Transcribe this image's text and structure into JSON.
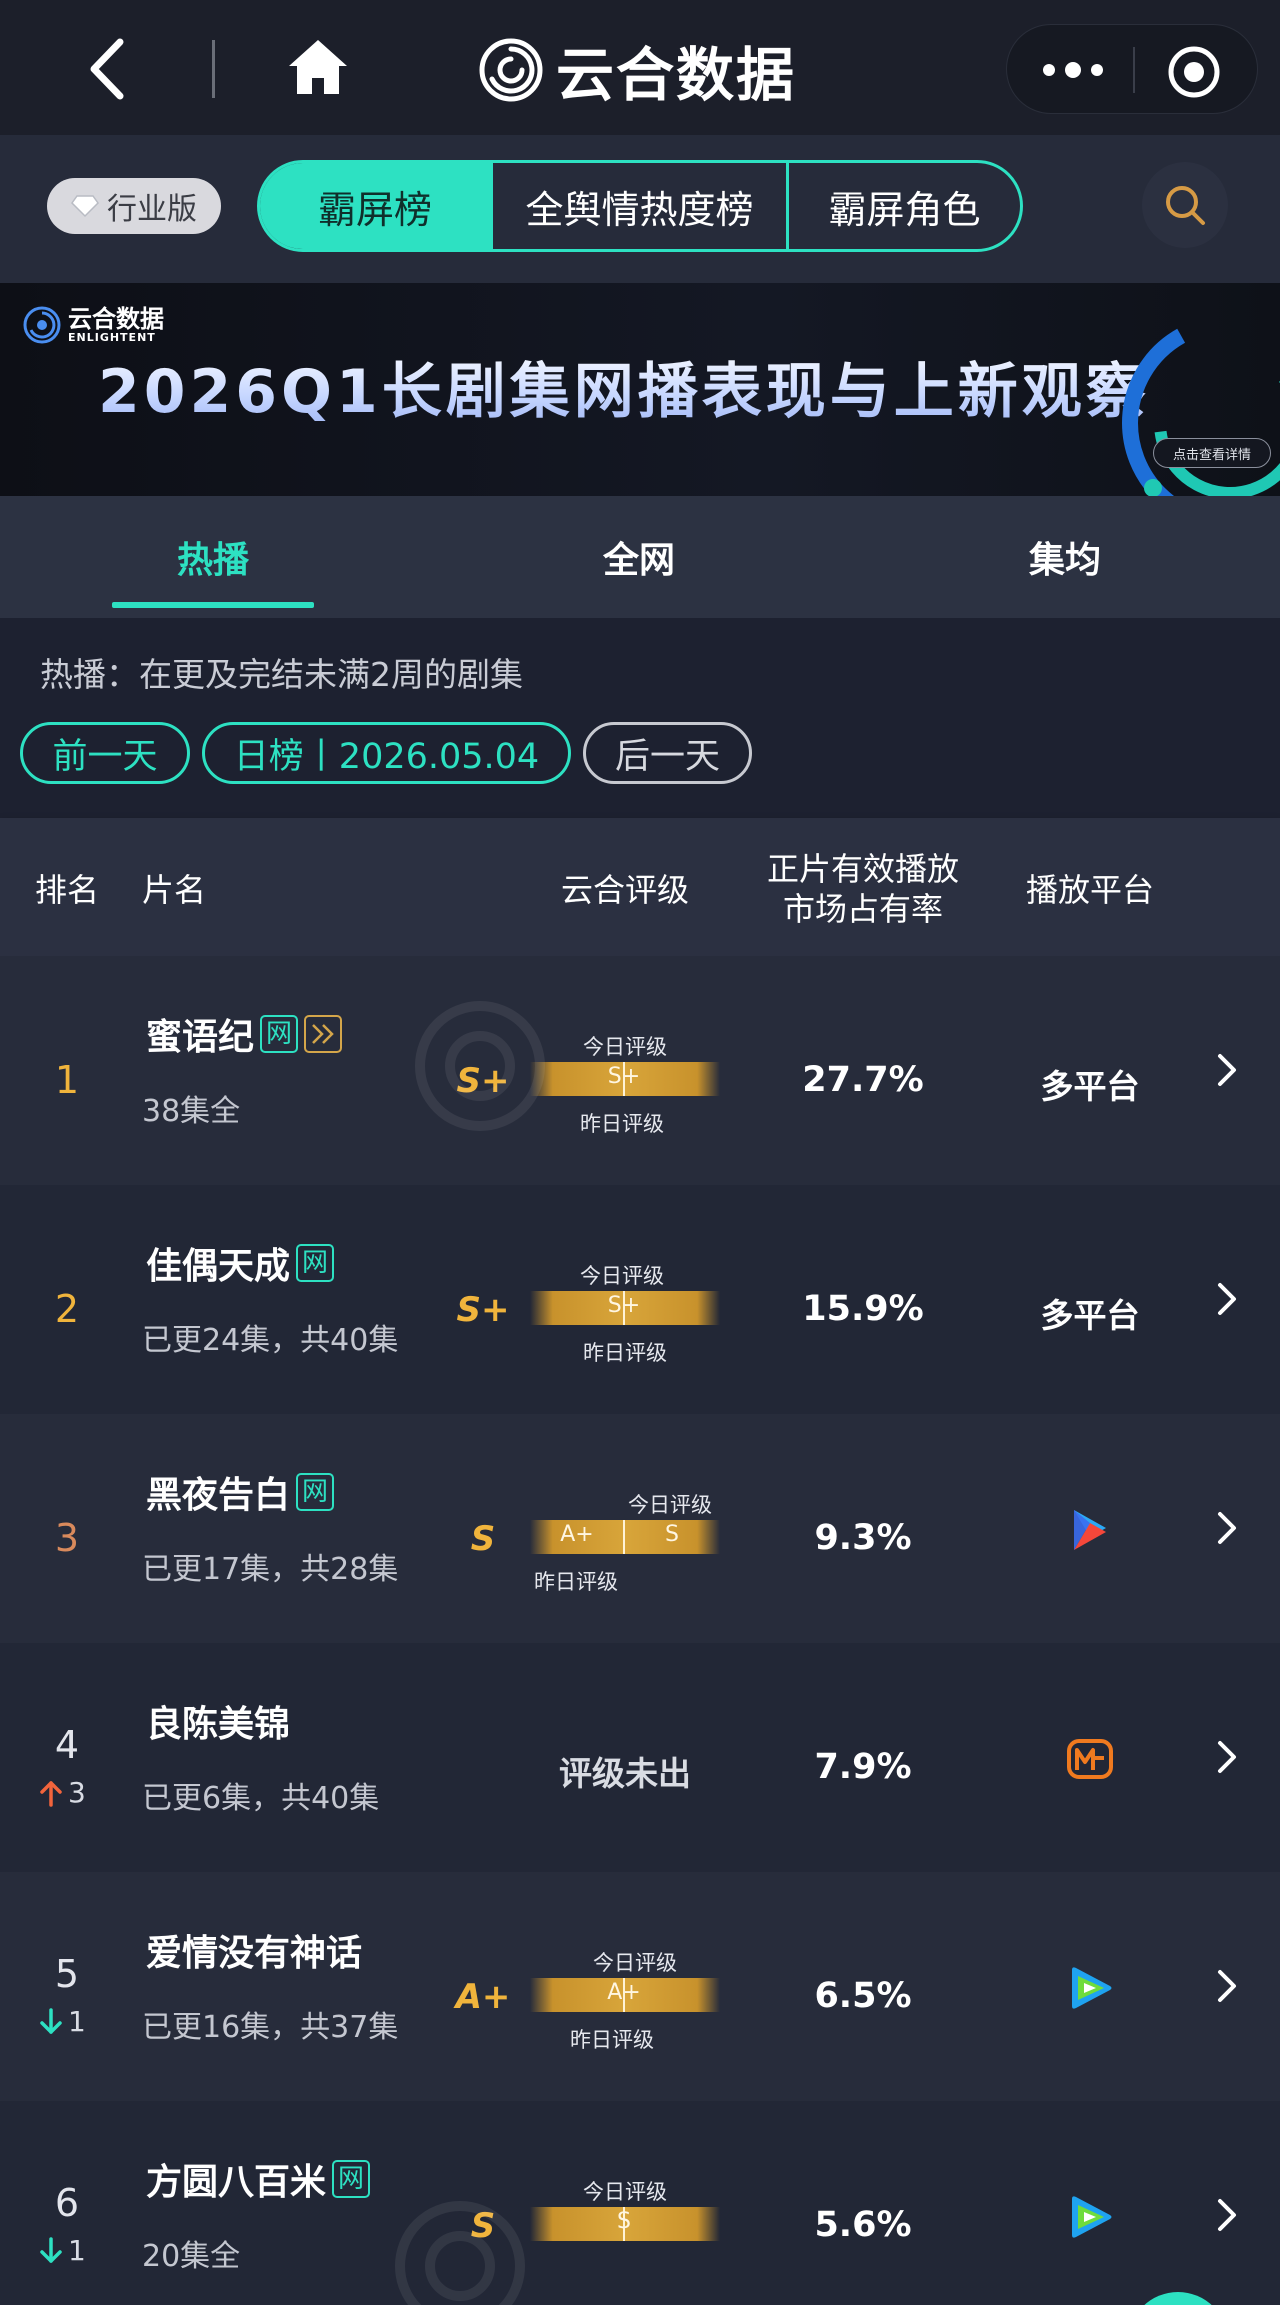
{
  "app": {
    "title": "云合数据"
  },
  "nav": {
    "industry_label": "行业版",
    "tabs": [
      "霸屏榜",
      "全舆情热度榜",
      "霸屏角色"
    ],
    "active_tab": 0
  },
  "banner": {
    "logo_cn": "云合数据",
    "logo_en": "ENLIGHTENT",
    "title": "2026Q1长剧集网播表现与上新观察",
    "cta": "点击查看详情"
  },
  "subtabs": {
    "items": [
      "热播",
      "全网",
      "集均"
    ],
    "active": 0
  },
  "description": "热播：在更及完结未满2周的剧集",
  "date_nav": {
    "prev": "前一天",
    "current": "日榜丨2026.05.04",
    "next": "后一天"
  },
  "table": {
    "headers": {
      "rank": "排名",
      "title": "片名",
      "grade": "云合评级",
      "share_line1": "正片有效播放",
      "share_line2": "市场占有率",
      "platform": "播放平台"
    },
    "grade_caps": {
      "today": "今日评级",
      "yesterday": "昨日评级"
    },
    "rows": [
      {
        "rank": "1",
        "title": "蜜语纪",
        "net_tag": "网",
        "has_ff_tag": true,
        "sub": "38集全",
        "grade": "S+",
        "bar_label": "S+",
        "share": "27.7%",
        "platform": "多平台",
        "platform_icon": ""
      },
      {
        "rank": "2",
        "title": "佳偶天成",
        "net_tag": "网",
        "has_ff_tag": false,
        "sub": "已更24集，共40集",
        "grade": "S+",
        "bar_label": "S+",
        "share": "15.9%",
        "platform": "多平台",
        "platform_icon": ""
      },
      {
        "rank": "3",
        "title": "黑夜告白",
        "net_tag": "网",
        "has_ff_tag": false,
        "sub": "已更17集，共28集",
        "grade": "S",
        "bar_label_yesterday": "A+",
        "bar_label_today": "S",
        "share": "9.3%",
        "platform": "",
        "platform_icon": "youku-icon"
      },
      {
        "rank": "4",
        "title": "良陈美锦",
        "net_tag": "",
        "has_ff_tag": false,
        "sub": "已更6集，共40集",
        "grade": "",
        "no_grade": "评级未出",
        "share": "7.9%",
        "platform": "",
        "platform_icon": "mango-tv-icon",
        "change_dir": "up",
        "change": "3"
      },
      {
        "rank": "5",
        "title": "爱情没有神话",
        "net_tag": "",
        "has_ff_tag": false,
        "sub": "已更16集，共37集",
        "grade": "A+",
        "bar_label": "A+",
        "share": "6.5%",
        "platform": "",
        "platform_icon": "tencent-video-icon",
        "change_dir": "down",
        "change": "1"
      },
      {
        "rank": "6",
        "title": "方圆八百米",
        "net_tag": "网",
        "has_ff_tag": false,
        "sub": "20集全",
        "grade": "S",
        "bar_label": "S",
        "share": "5.6%",
        "platform": "",
        "platform_icon": "tencent-video-icon",
        "change_dir": "down",
        "change": "1"
      }
    ]
  },
  "colors": {
    "accent": "#2de1c2",
    "gold": "#f0b43c",
    "rank_top": "#f0b43c",
    "up": "#f2643c",
    "down": "#2de1c2"
  }
}
